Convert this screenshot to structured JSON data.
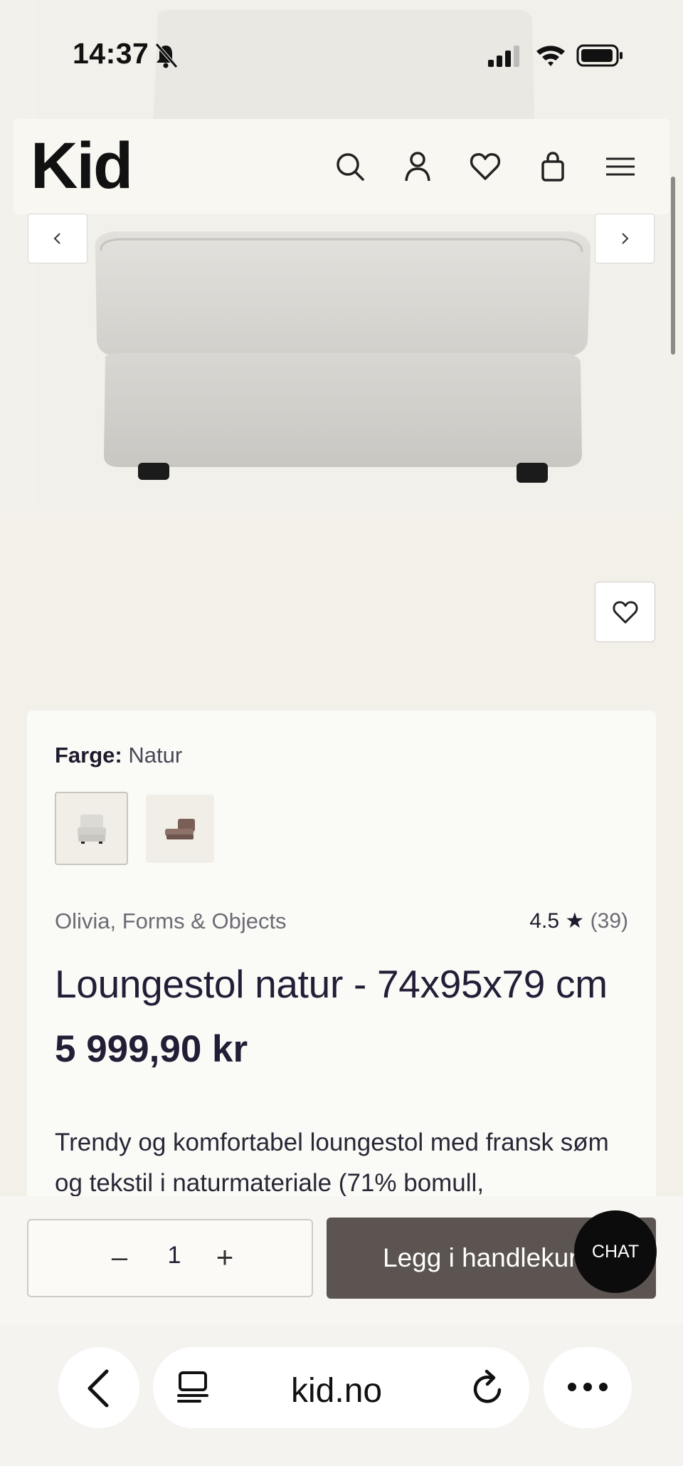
{
  "status_bar": {
    "time": "14:37"
  },
  "header": {
    "logo": "Kid"
  },
  "product": {
    "color_label": "Farge:",
    "color_value": "Natur",
    "brand": "Olivia, Forms & Objects",
    "rating_score": "4.5",
    "rating_star": "★",
    "rating_count": "(39)",
    "title": "Loungestol natur - 74x95x79 cm",
    "price": "5 999,90 kr",
    "description": "Trendy og komfortabel loungestol med fransk søm og tekstil i naturmateriale (71% bomull,"
  },
  "cart_bar": {
    "qty_minus": "–",
    "qty_value": "1",
    "qty_plus": "+",
    "add_label": "Legg i handlekurv",
    "chat_label": "CHAT"
  },
  "browser": {
    "url": "kid.no"
  },
  "colors": {
    "page_bg": "#f3f0ea",
    "card_bg": "#fafaf7",
    "button_dark": "#5c5450",
    "chat_bg": "#0c0c0c"
  },
  "icons": [
    "search-icon",
    "account-icon",
    "heart-icon",
    "bag-icon",
    "menu-icon",
    "chevron-left-icon",
    "chevron-right-icon",
    "back-icon",
    "tabs-icon",
    "reload-icon",
    "more-icon"
  ]
}
